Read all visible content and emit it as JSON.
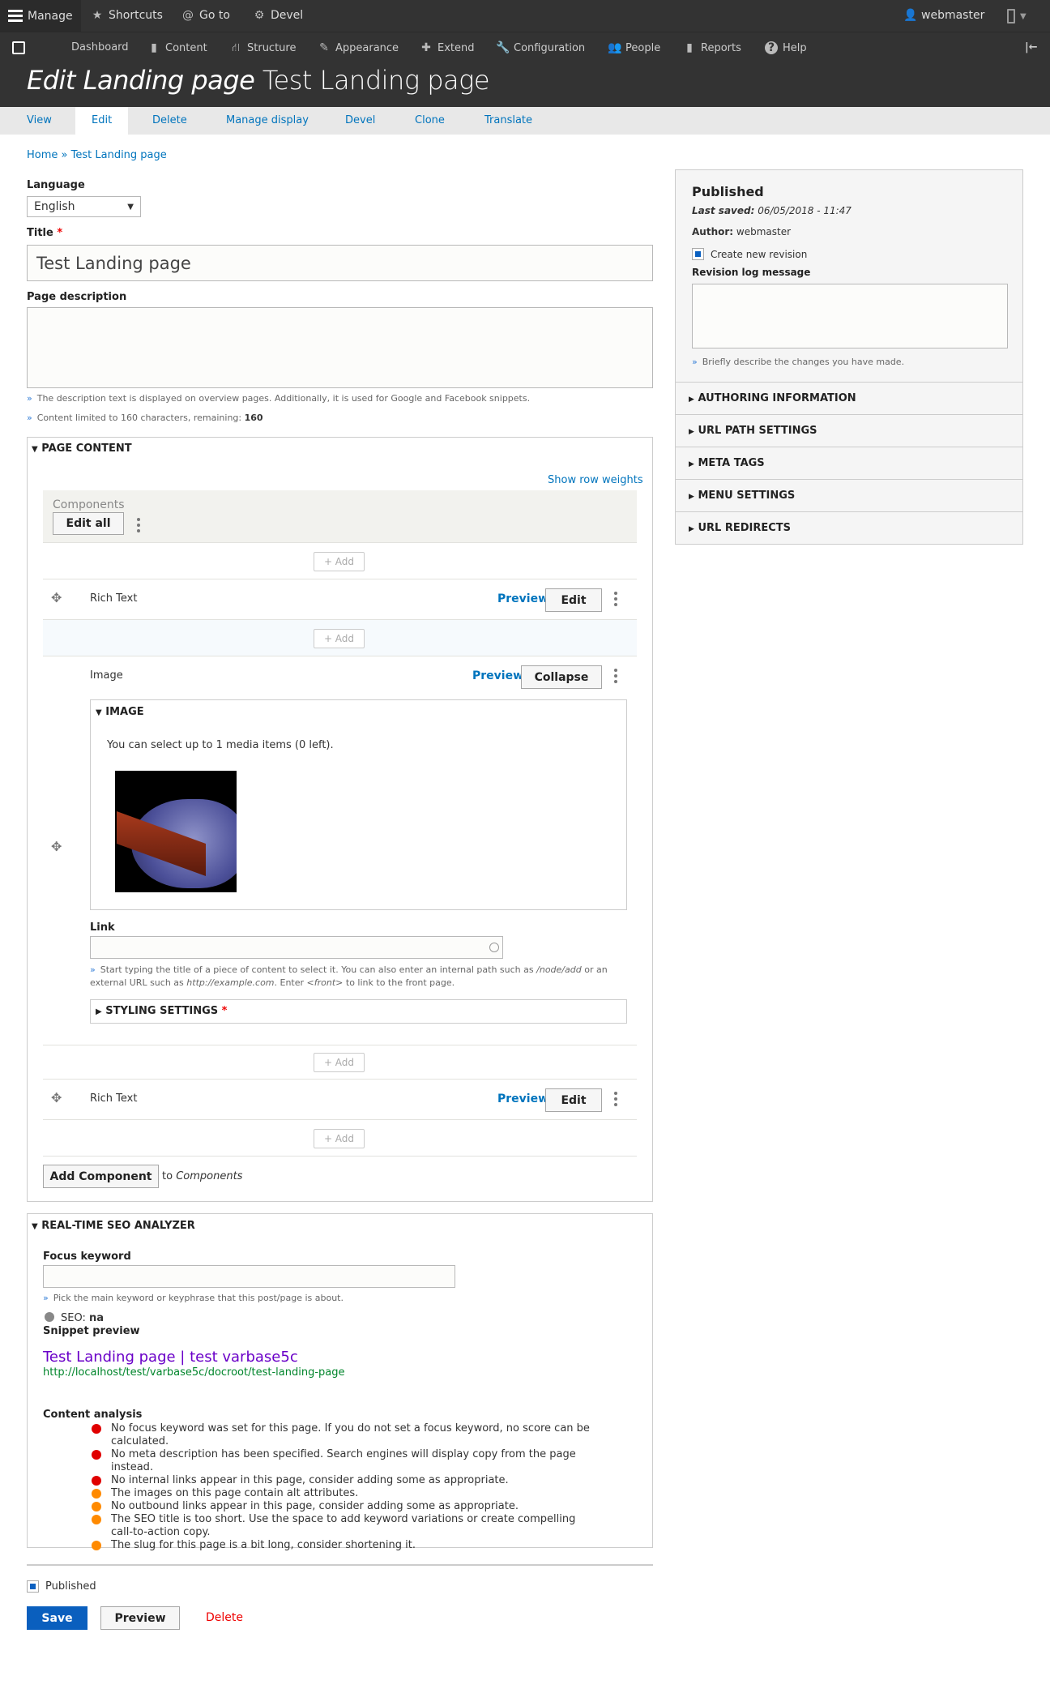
{
  "toolbar": {
    "manage": "Manage",
    "shortcuts": "Shortcuts",
    "goto": "Go to",
    "devel": "Devel",
    "user": "webmaster"
  },
  "tray": [
    "Dashboard",
    "Content",
    "Structure",
    "Appearance",
    "Extend",
    "Configuration",
    "People",
    "Reports",
    "Help"
  ],
  "header": {
    "title_italic": "Edit Landing page",
    "title_rest": "Test Landing page"
  },
  "tabs": [
    "View",
    "Edit",
    "Delete",
    "Manage display",
    "Devel",
    "Clone",
    "Translate"
  ],
  "breadcrumb": {
    "home": "Home",
    "sep": "»",
    "current": "Test Landing page"
  },
  "form": {
    "language_label": "Language",
    "language_value": "English",
    "title_label": "Title",
    "required": "*",
    "title_value": "Test Landing page",
    "desc_label": "Page description",
    "desc_help": "The description text is displayed on overview pages. Additionally, it is used for Google and Facebook snippets.",
    "desc_limit": "Content limited to 160 characters, remaining:",
    "desc_remaining": "160",
    "raquo": "»"
  },
  "page_content": {
    "legend": "PAGE CONTENT",
    "show_weights": "Show row weights",
    "components": "Components",
    "edit_all": "Edit all",
    "add": "+ Add",
    "rich_text": "Rich Text",
    "image": "Image",
    "preview": "Preview",
    "edit": "Edit",
    "collapse": "Collapse",
    "image_legend": "IMAGE",
    "media_note": "You can select up to 1 media items (0 left).",
    "link_label": "Link",
    "link_help_1": "Start typing the title of a piece of content to select it. You can also enter an internal path such as",
    "link_help_path": "/node/add",
    "link_help_2": "or an external URL such as",
    "link_help_url": "http://example.com",
    "link_help_3": ". Enter",
    "link_help_front": "<front>",
    "link_help_4": "to link to the front page.",
    "styling": "STYLING SETTINGS",
    "add_component": "Add Component",
    "to": "to",
    "to_target": "Components"
  },
  "seo": {
    "legend": "REAL-TIME SEO ANALYZER",
    "focus_label": "Focus keyword",
    "focus_help": "Pick the main keyword or keyphrase that this post/page is about.",
    "score_label": "SEO:",
    "score_value": "na",
    "snippet_label": "Snippet preview",
    "snippet_title": "Test Landing page | test varbase5c",
    "snippet_url": "http://localhost/test/varbase5c/docroot/test-landing-page",
    "analysis_label": "Content analysis",
    "items": [
      {
        "color": "#e00000",
        "text": "No focus keyword was set for this page. If you do not set a focus keyword, no score can be calculated."
      },
      {
        "color": "#e00000",
        "text": "No meta description has been specified. Search engines will display copy from the page instead."
      },
      {
        "color": "#e00000",
        "text": "No internal links appear in this page, consider adding some as appropriate."
      },
      {
        "color": "#ff8a00",
        "text": "The images on this page contain alt attributes."
      },
      {
        "color": "#ff8a00",
        "text": "No outbound links appear in this page, consider adding some as appropriate."
      },
      {
        "color": "#ff8a00",
        "text": "The SEO title is too short. Use the space to add keyword variations or create compelling call-to-action copy."
      },
      {
        "color": "#ff8a00",
        "text": "The slug for this page is a bit long, consider shortening it."
      }
    ]
  },
  "footer": {
    "published": "Published",
    "save": "Save",
    "preview": "Preview",
    "delete": "Delete"
  },
  "sidebar": {
    "status": "Published",
    "last_saved_label": "Last saved:",
    "last_saved": "06/05/2018 - 11:47",
    "author_label": "Author:",
    "author": "webmaster",
    "new_revision": "Create new revision",
    "log_label": "Revision log message",
    "log_help": "Briefly describe the changes you have made.",
    "sections": [
      "AUTHORING INFORMATION",
      "URL PATH SETTINGS",
      "META TAGS",
      "MENU SETTINGS",
      "URL REDIRECTS"
    ]
  }
}
